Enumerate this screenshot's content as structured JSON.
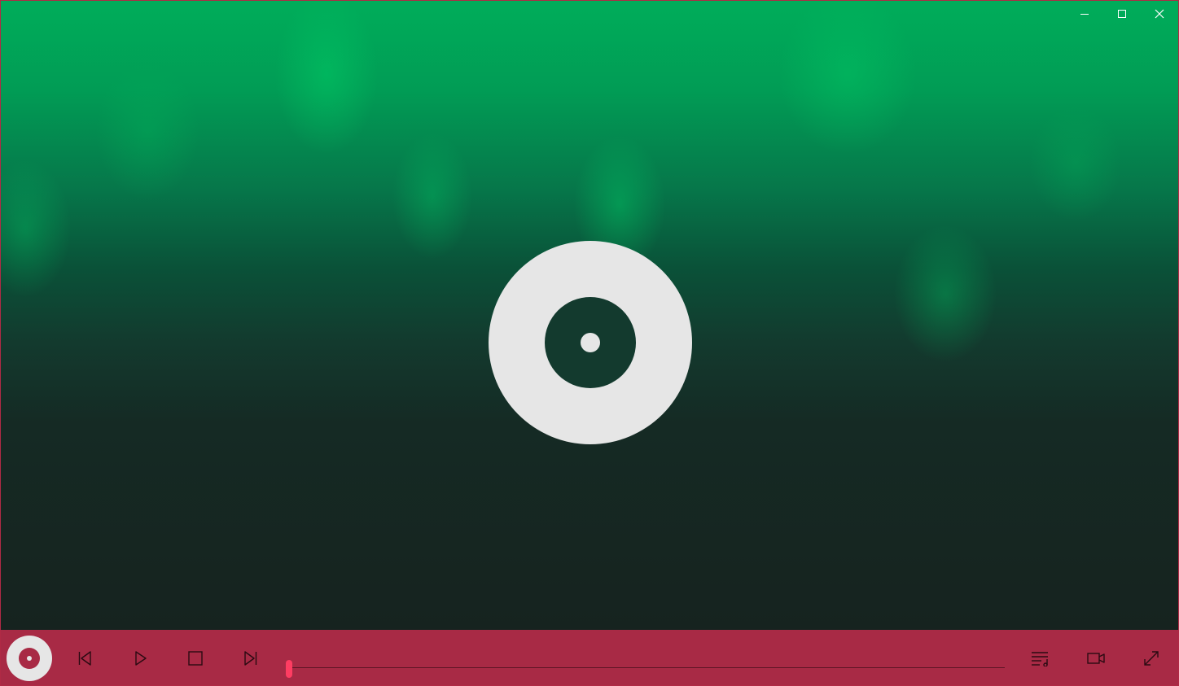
{
  "window": {
    "controls": {
      "minimize_icon": "minimize-icon",
      "maximize_icon": "maximize-icon",
      "close_icon": "close-icon"
    }
  },
  "visual": {
    "placeholder_icon": "disc-icon",
    "colors": {
      "top_glow": "#00ad5a",
      "background": "#16231f",
      "disc": "#e6e6e6"
    }
  },
  "controlbar": {
    "color": "#a82a45",
    "accent": "#ff3d62",
    "buttons": [
      {
        "name": "previous",
        "icon": "skip-previous-icon"
      },
      {
        "name": "play",
        "icon": "play-icon"
      },
      {
        "name": "stop",
        "icon": "stop-icon"
      },
      {
        "name": "next",
        "icon": "skip-next-icon"
      },
      {
        "name": "playlist",
        "icon": "playlist-icon"
      },
      {
        "name": "video",
        "icon": "video-camera-icon"
      },
      {
        "name": "fullscreen",
        "icon": "fullscreen-icon"
      }
    ],
    "progress": 0.0
  }
}
